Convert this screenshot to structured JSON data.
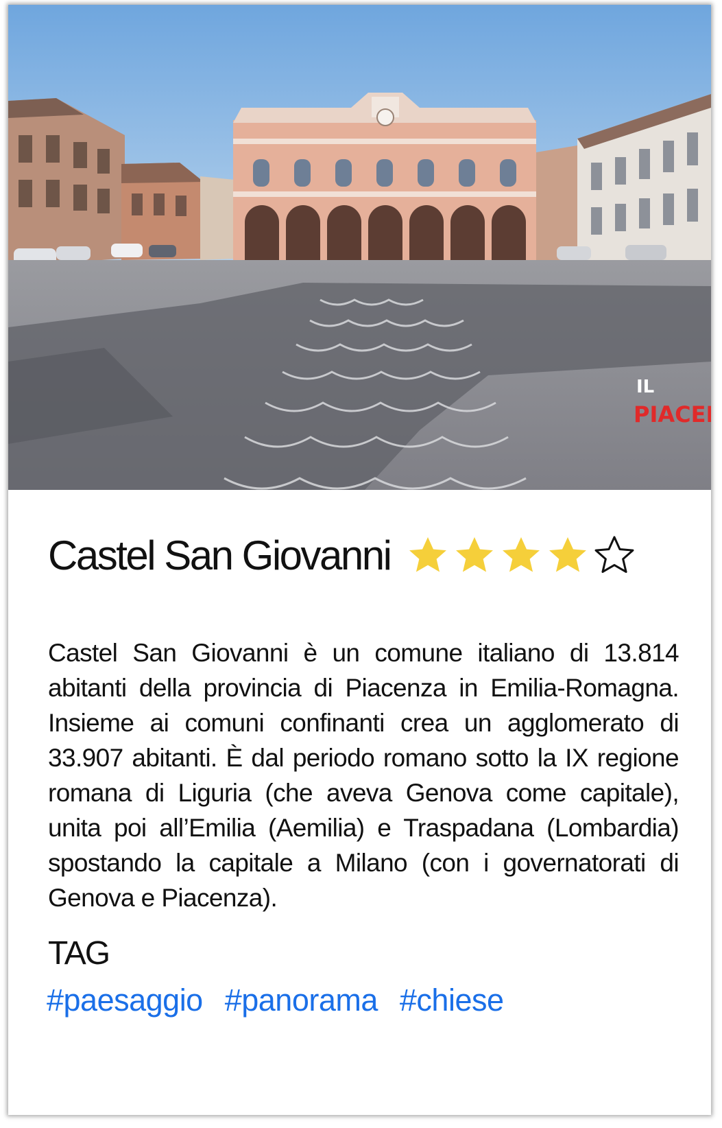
{
  "place": {
    "title": "Castel San Giovanni",
    "rating": 4,
    "rating_max": 5,
    "description": "Castel San Giovanni è un comune italiano di 13.814 abitanti della provincia di Piacenza in Emilia-Romagna. Insieme ai comuni confinanti crea un agglomerato di 33.907 abitanti. È dal periodo romano sotto la IX regione romana di Liguria (che aveva Genova come capitale), unita poi all’Emilia (Aemilia) e Traspadana (Lombardia) spostando la capitale a Milano (con i governatorati di Genova e Piacenza).",
    "photo": {
      "watermark_line1": "IL",
      "watermark_line2": "PIACEN"
    }
  },
  "tags_section": {
    "heading": "TAG",
    "tags": [
      "#paesaggio",
      "#panorama",
      "#chiese"
    ]
  },
  "colors": {
    "star_filled": "#F5CF3A",
    "star_empty_stroke": "#111111",
    "tag_link": "#1A6FE8",
    "title": "#111111"
  },
  "icons": {
    "star_filled": "star-filled-icon",
    "star_empty": "star-outline-icon"
  }
}
